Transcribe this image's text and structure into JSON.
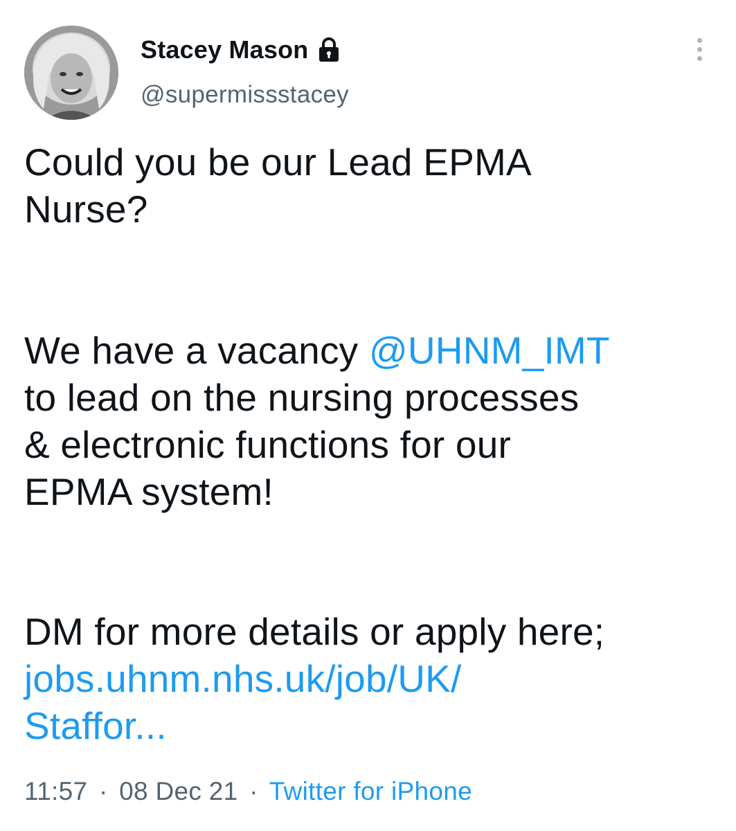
{
  "author": {
    "display_name": "Stacey Mason",
    "handle": "@supermissstacey",
    "protected_icon": "lock-icon",
    "avatar_icon": "profile-photo"
  },
  "menu": {
    "icon": "more-vertical-icon"
  },
  "tweet": {
    "p1": {
      "line1": "Could you be our Lead EPMA",
      "line2": "Nurse?"
    },
    "p2": {
      "line1_text": "We have a vacancy ",
      "mention": "@UHNM_IMT",
      "line2": "to lead on the nursing processes",
      "line3": "& electronic functions for our",
      "line4": "EPMA system!"
    },
    "p3": {
      "line1": "DM for more details or apply here;",
      "link_line1": "jobs.uhnm.nhs.uk/job/UK/",
      "link_line2": "Staffor..."
    }
  },
  "meta": {
    "time": "11:57",
    "separator": "·",
    "date": "08 Dec 21",
    "source": "Twitter for iPhone"
  },
  "colors": {
    "text": "#0f1419",
    "secondary": "#536471",
    "link": "#1d9bf0",
    "background": "#ffffff"
  }
}
